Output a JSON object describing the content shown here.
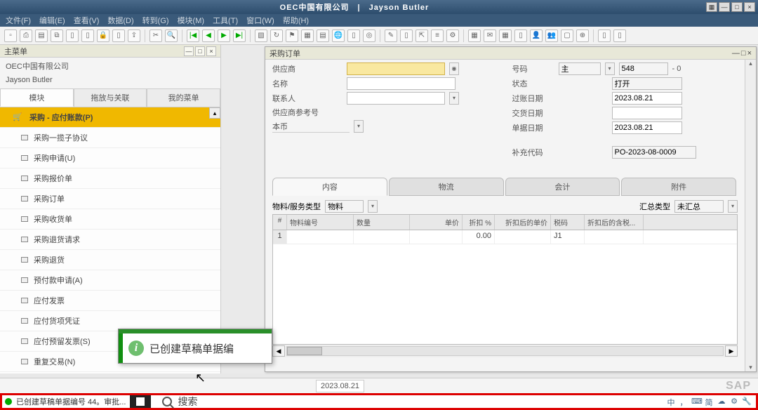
{
  "titlebar": {
    "title": "OEC中国有限公司　|　Jayson Butler"
  },
  "menubar": {
    "items": [
      "文件(F)",
      "编辑(E)",
      "查看(V)",
      "数据(D)",
      "转到(G)",
      "模块(M)",
      "工具(T)",
      "窗口(W)",
      "帮助(H)"
    ]
  },
  "left": {
    "panel_title": "主菜单",
    "company": "OEC中国有限公司",
    "user": "Jayson Butler",
    "tabs": {
      "t0": "模块",
      "t1": "拖放与关联",
      "t2": "我的菜单"
    },
    "items": {
      "i0": "采购 - 应付账款(P)",
      "i1": "采购一揽子协议",
      "i2": "采购申请(U)",
      "i3": "采购报价单",
      "i4": "采购订单",
      "i5": "采购收货单",
      "i6": "采购退货请求",
      "i7": "采购退货",
      "i8": "预付款申请(A)",
      "i9": "应付发票",
      "i10": "应付货项凭证",
      "i11": "应付预留发票(S)",
      "i12": "重复交易(N)"
    }
  },
  "form": {
    "title": "采购订单",
    "labels": {
      "vendor": "供应商",
      "name": "名称",
      "contact": "联系人",
      "vendor_ref": "供应商参考号",
      "currency": "本币",
      "doc_no": "号码",
      "status": "状态",
      "post_date": "过账日期",
      "deliv_date": "交货日期",
      "doc_date": "单据日期",
      "extra_code": "补充代码"
    },
    "values": {
      "doc_no_type": "主",
      "doc_no": "548",
      "doc_no_suffix": "- 0",
      "status": "打开",
      "post_date": "2023.08.21",
      "deliv_date": "",
      "doc_date": "2023.08.21",
      "extra_code": "PO-2023-08-0009"
    },
    "subtabs": {
      "t0": "内容",
      "t1": "物流",
      "t2": "会计",
      "t3": "附件"
    },
    "grid_controls": {
      "item_type_label": "物料/服务类型",
      "item_type_value": "物料",
      "sum_type_label": "汇总类型",
      "sum_type_value": "未汇总"
    },
    "grid": {
      "headers": {
        "h0": "#",
        "h1": "物料编号",
        "h2": "数量",
        "h3": "单价",
        "h4": "折扣 %",
        "h5": "折扣后的单价",
        "h6": "税码",
        "h7": "折扣后的含税..."
      },
      "row1": {
        "num": "1",
        "discount": "0.00",
        "tax": "J1"
      }
    }
  },
  "popup": {
    "text": "已创建草稿单据编"
  },
  "statusbar": {
    "date": "2023.08.21",
    "sap": "SAP"
  },
  "taskbar": {
    "status_left": "已创建草稿单据编号 44。审批...",
    "search": "搜索",
    "tray_chinese": "中"
  },
  "rsearch": "搜索"
}
